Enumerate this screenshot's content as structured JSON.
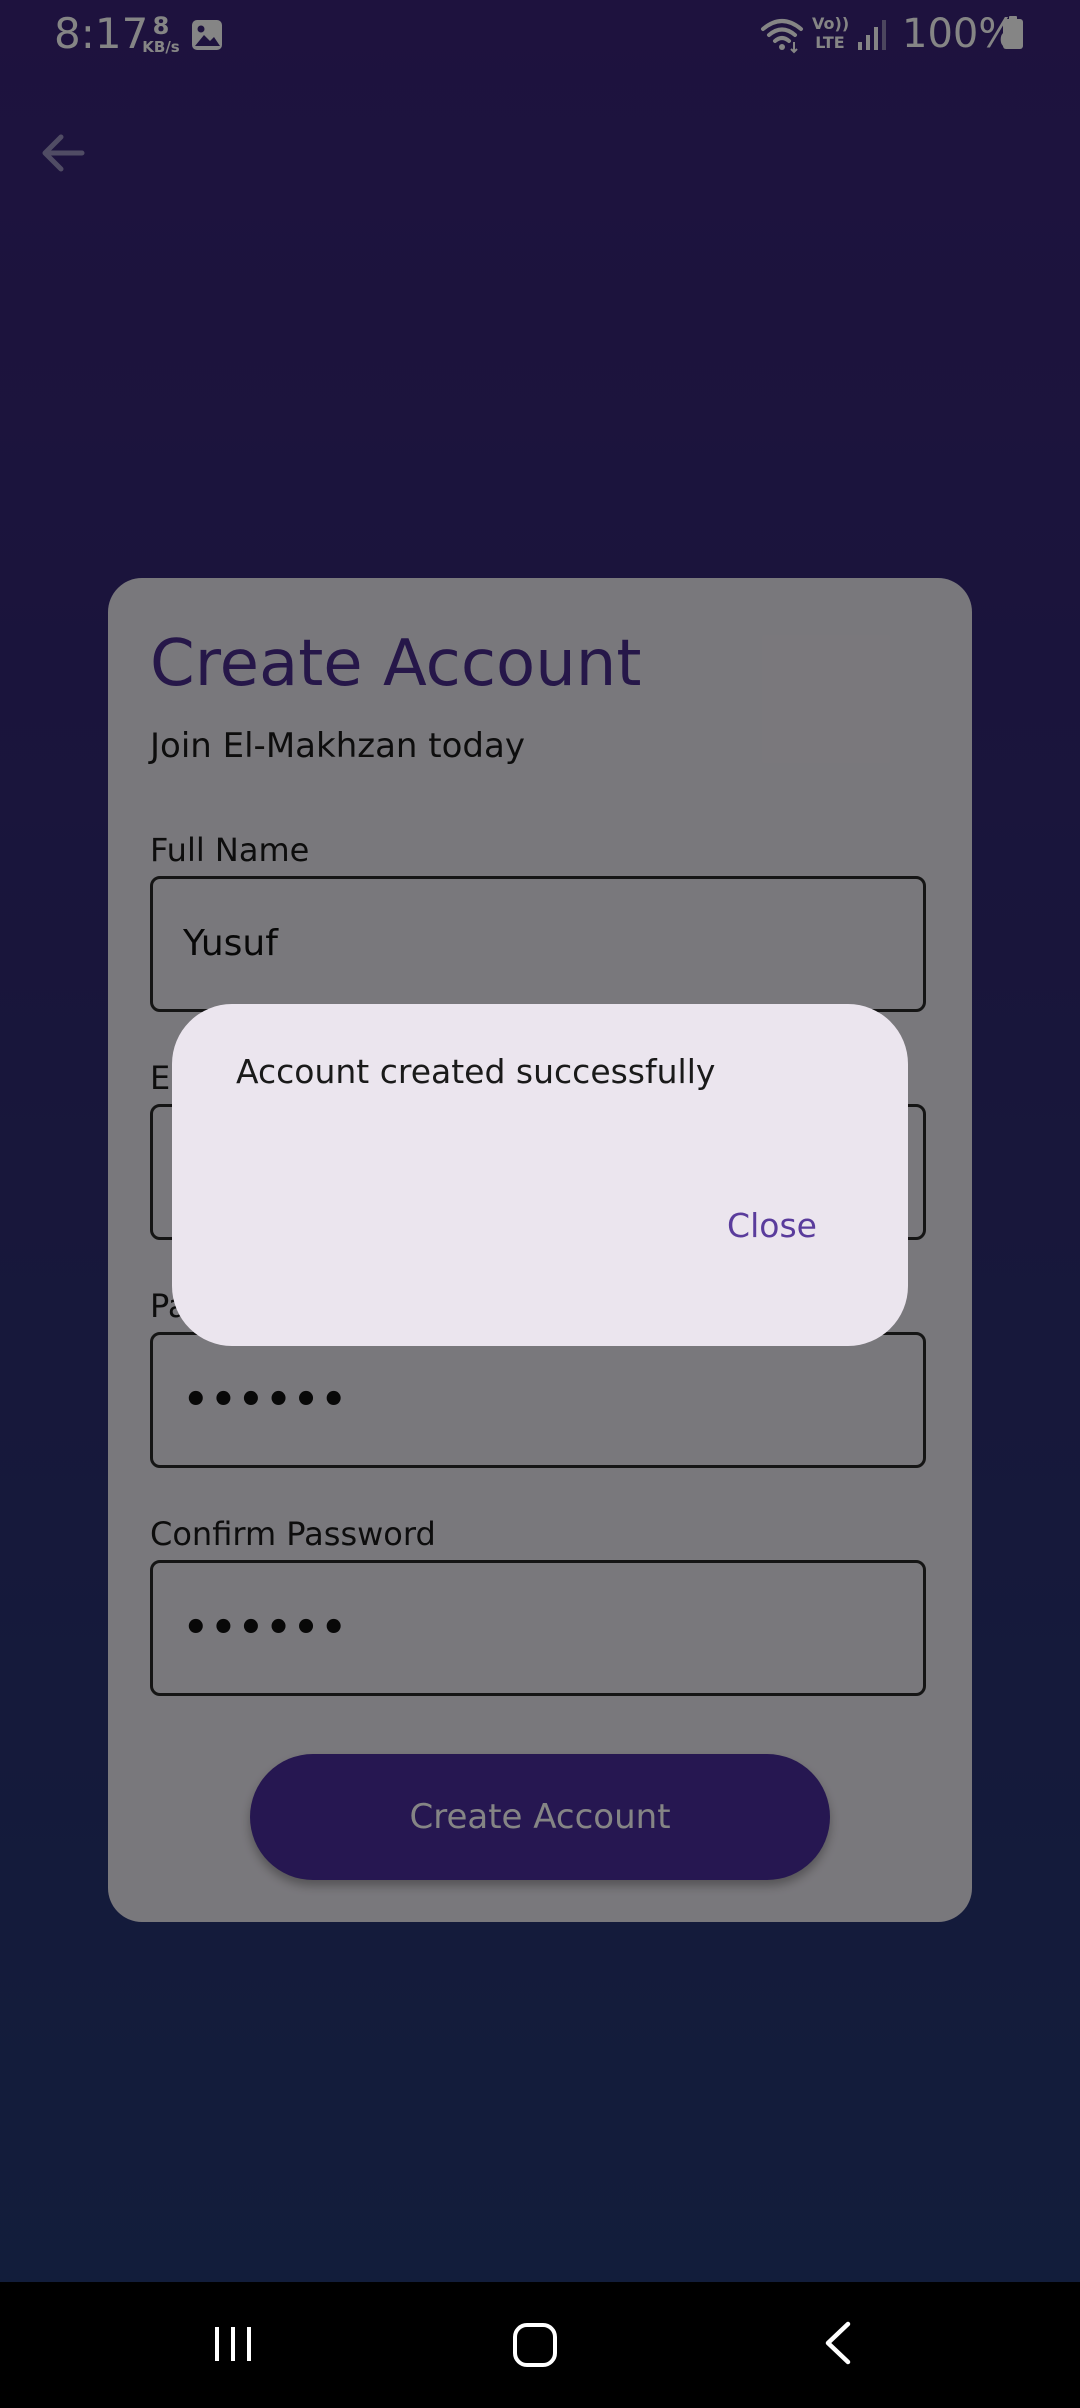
{
  "status_bar": {
    "time": "8:17",
    "speed_value": "8",
    "speed_unit": "KB/s",
    "volte_line1": "Vo))",
    "volte_line2": "LTE",
    "battery": "100%",
    "icons": [
      "gallery-icon",
      "wifi-icon",
      "volte-icon",
      "signal-icon",
      "battery-icon"
    ]
  },
  "header": {
    "back_icon": "arrow-left-icon"
  },
  "form": {
    "title": "Create Account",
    "subtitle": "Join El-Makhzan today",
    "fields": [
      {
        "label": "Full Name",
        "value": "Yusuf"
      },
      {
        "label": "Email",
        "value": ""
      },
      {
        "label": "Password",
        "value": "••••••"
      },
      {
        "label": "Confirm Password",
        "value": "••••••"
      }
    ],
    "submit_label": "Create Account"
  },
  "dialog": {
    "message": "Account created successfully",
    "close_label": "Close"
  },
  "nav_bar": {
    "icons": [
      "recents-icon",
      "home-icon",
      "back-icon"
    ]
  },
  "colors": {
    "title_accent": "#4a2d8c",
    "button_bg": "#4a2d9c",
    "dialog_bg": "#ebe5ee",
    "dialog_action": "#5a3c9c",
    "background_top": "#3a2478",
    "background_bottom": "#233a72"
  }
}
